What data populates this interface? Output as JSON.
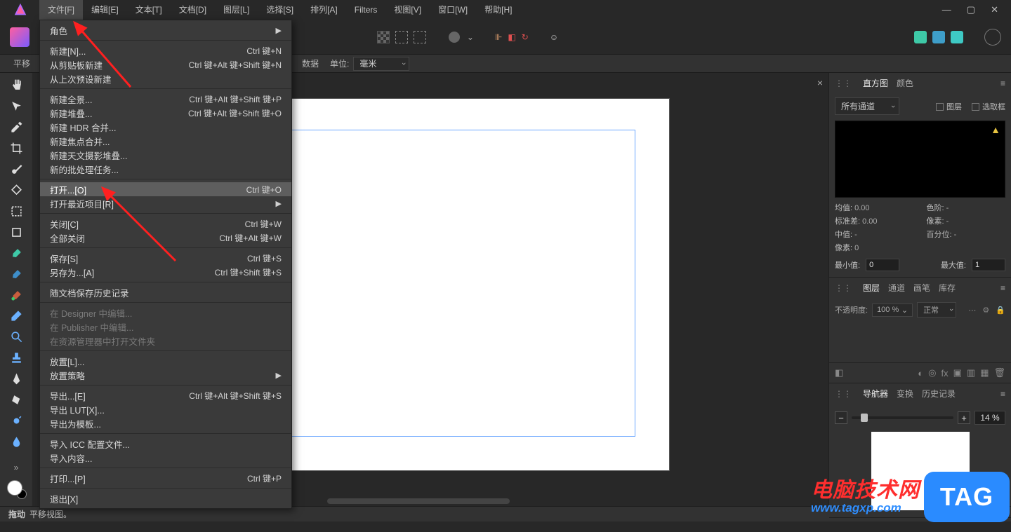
{
  "menubar": {
    "items": [
      "文件[F]",
      "编辑[E]",
      "文本[T]",
      "文档[D]",
      "图层[L]",
      "选择[S]",
      "排列[A]",
      "Filters",
      "视图[V]",
      "窗口[W]",
      "帮助[H]"
    ],
    "active_index": 0
  },
  "contextbar": {
    "panmove": "平移",
    "data_dropdown_label": "数据",
    "unit_label": "单位:",
    "unit_value": "毫米"
  },
  "tools": [
    "hand",
    "move",
    "pick",
    "crop",
    "brush",
    "gradient",
    "marquee",
    "shape",
    "paint",
    "paint2",
    "colorbrush",
    "blend",
    "spot",
    "erase",
    "zoom",
    "fill",
    "smudge",
    "water"
  ],
  "file_menu": {
    "items": [
      {
        "label": "角色",
        "sub": "▶"
      },
      {
        "sep": true
      },
      {
        "label": "新建[N]...",
        "shortcut": "Ctrl 键+N"
      },
      {
        "label": "从剪贴板新建",
        "shortcut": "Ctrl 键+Alt 键+Shift 键+N"
      },
      {
        "label": "从上次预设新建"
      },
      {
        "sep": true
      },
      {
        "label": "新建全景...",
        "shortcut": "Ctrl 键+Alt 键+Shift 键+P"
      },
      {
        "label": "新建堆叠...",
        "shortcut": "Ctrl 键+Alt 键+Shift 键+O"
      },
      {
        "label": "新建 HDR 合并..."
      },
      {
        "label": "新建焦点合并..."
      },
      {
        "label": "新建天文摄影堆叠..."
      },
      {
        "label": "新的批处理任务..."
      },
      {
        "sep": true
      },
      {
        "label": "打开...[O]",
        "shortcut": "Ctrl 键+O",
        "hover": true
      },
      {
        "label": "打开最近项目[R]",
        "sub": "▶"
      },
      {
        "sep": true
      },
      {
        "label": "关闭[C]",
        "shortcut": "Ctrl 键+W"
      },
      {
        "label": "全部关闭",
        "shortcut": "Ctrl 键+Alt 键+W"
      },
      {
        "sep": true
      },
      {
        "label": "保存[S]",
        "shortcut": "Ctrl 键+S"
      },
      {
        "label": "另存为...[A]",
        "shortcut": "Ctrl 键+Shift 键+S"
      },
      {
        "sep": true
      },
      {
        "label": "随文档保存历史记录"
      },
      {
        "sep": true
      },
      {
        "label": "在 Designer 中编辑...",
        "disabled": true
      },
      {
        "label": "在 Publisher 中编辑...",
        "disabled": true
      },
      {
        "label": "在资源管理器中打开文件夹",
        "disabled": true
      },
      {
        "sep": true
      },
      {
        "label": "放置[L]..."
      },
      {
        "label": "放置策略",
        "sub": "▶"
      },
      {
        "sep": true
      },
      {
        "label": "导出...[E]",
        "shortcut": "Ctrl 键+Alt 键+Shift 键+S"
      },
      {
        "label": "导出 LUT[X]..."
      },
      {
        "label": "导出为模板..."
      },
      {
        "sep": true
      },
      {
        "label": "导入 ICC 配置文件..."
      },
      {
        "label": "导入内容..."
      },
      {
        "sep": true
      },
      {
        "label": "打印...[P]",
        "shortcut": "Ctrl 键+P"
      },
      {
        "sep": true
      },
      {
        "label": "退出[X]"
      }
    ]
  },
  "right": {
    "hist": {
      "tabs": [
        "直方图",
        "颜色"
      ],
      "channel": "所有通道",
      "checks": [
        "图层",
        "选取框"
      ],
      "stats": {
        "mean_k": "均值:",
        "mean_v": "0.00",
        "sd_k": "标准差:",
        "sd_v": "0.00",
        "med_k": "中值:",
        "med_v": "-",
        "px_k": "像素:",
        "px_v": "0",
        "lvl_k": "色阶:",
        "lvl_v": "-",
        "pxs_k": "像素:",
        "pxs_v": "-",
        "pct_k": "百分位:",
        "pct_v": "-"
      },
      "min_label": "最小值:",
      "min_value": "0",
      "max_label": "最大值:",
      "max_value": "1"
    },
    "layers": {
      "tabs": [
        "图层",
        "通道",
        "画笔",
        "库存"
      ],
      "opacity_label": "不透明度:",
      "opacity_value": "100 %",
      "blend_value": "正常"
    },
    "nav": {
      "tabs": [
        "导航器",
        "变换",
        "历史记录"
      ],
      "zoom_value": "14 %"
    }
  },
  "statusbar": {
    "bold": "拖动",
    "text": "平移视图。"
  },
  "watermark": {
    "line1": "电脑技术网",
    "line2": "www.tagxp.com",
    "tag": "TAG"
  }
}
